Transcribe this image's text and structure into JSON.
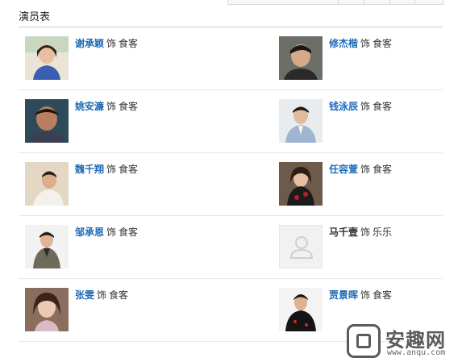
{
  "section": {
    "title": "演员表"
  },
  "cast": [
    {
      "actor": "谢承颖",
      "sep": "饰",
      "role": "食客",
      "photo": "face"
    },
    {
      "actor": "修杰楷",
      "sep": "饰",
      "role": "食客",
      "photo": "face"
    },
    {
      "actor": "姚安濂",
      "sep": "饰",
      "role": "食客",
      "photo": "face"
    },
    {
      "actor": "钱泳辰",
      "sep": "饰",
      "role": "食客",
      "photo": "face"
    },
    {
      "actor": "魏千翔",
      "sep": "饰",
      "role": "食客",
      "photo": "face"
    },
    {
      "actor": "任容萱",
      "sep": "饰",
      "role": "食客",
      "photo": "face"
    },
    {
      "actor": "邹承恩",
      "sep": "饰",
      "role": "食客",
      "photo": "face"
    },
    {
      "actor": "马千壹",
      "sep": "饰",
      "role": "乐乐",
      "photo": "placeholder-user-icon"
    },
    {
      "actor": "张雯",
      "sep": "饰",
      "role": "食客",
      "photo": "face"
    },
    {
      "actor": "贾景晖",
      "sep": "饰",
      "role": "食客",
      "photo": "face"
    }
  ],
  "watermark": {
    "brand": "安趣网",
    "url": "www.anqu.com"
  },
  "colors": {
    "link": "#1e6bb8",
    "text": "#333333",
    "divider": "#e6e6e6"
  }
}
